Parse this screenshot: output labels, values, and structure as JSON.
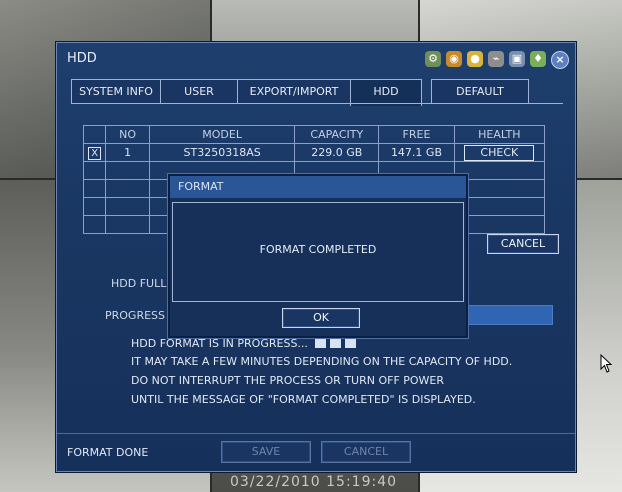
{
  "window": {
    "title": "HDD"
  },
  "toolbar_icons": [
    "tools-icon",
    "camera-icon",
    "record-icon",
    "network-icon",
    "display-icon",
    "lock-icon",
    "close-icon"
  ],
  "tabs": [
    {
      "label": "SYSTEM INFO"
    },
    {
      "label": "USER"
    },
    {
      "label": "EXPORT/IMPORT"
    },
    {
      "label": "HDD"
    },
    {
      "label": "DEFAULT"
    }
  ],
  "hdd_table": {
    "headers": [
      "NO",
      "MODEL",
      "CAPACITY",
      "FREE",
      "HEALTH"
    ],
    "rows": [
      {
        "checked": "X",
        "no": "1",
        "model": "ST3250318AS",
        "capacity": "229.0 GB",
        "free": "147.1 GB",
        "health": "CHECK"
      }
    ]
  },
  "cancel_label": "CANCEL",
  "hdd_full_label": "HDD FULL",
  "progress_label": "PROGRESS",
  "progress_msg": "HDD FORMAT IS IN PROGRESS...",
  "info_lines": [
    "IT MAY TAKE A FEW MINUTES DEPENDING ON THE CAPACITY OF HDD.",
    "DO NOT INTERRUPT THE PROCESS OR TURN OFF POWER",
    "UNTIL THE MESSAGE OF \"FORMAT COMPLETED\" IS DISPLAYED."
  ],
  "status": "FORMAT DONE",
  "footer": {
    "save_label": "SAVE",
    "cancel_label": "CANCEL"
  },
  "popup": {
    "title": "FORMAT",
    "message": "FORMAT COMPLETED",
    "ok_label": "OK"
  },
  "timestamp": "03/22/2010 15:19:40"
}
